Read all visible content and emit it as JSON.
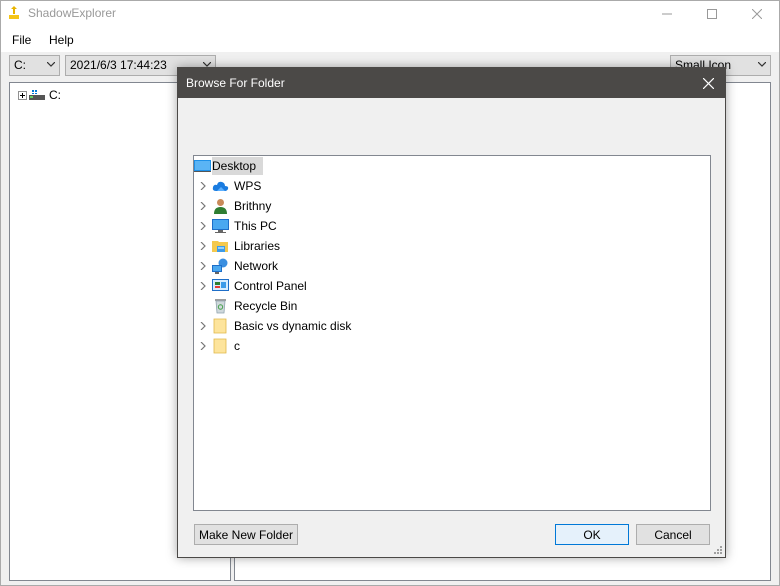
{
  "app": {
    "title": "ShadowExplorer",
    "menu": [
      "File",
      "Help"
    ],
    "toolbar": {
      "drive": "C:",
      "snapshot": "2021/6/3 17:44:23",
      "view_mode": "Small Icon"
    },
    "tree": {
      "root_label": "C:"
    }
  },
  "dialog": {
    "title": "Browse For Folder",
    "items": [
      {
        "label": "Desktop",
        "icon": "desktop-icon"
      },
      {
        "label": "WPS",
        "icon": "cloud-icon"
      },
      {
        "label": "Brithny",
        "icon": "user-icon"
      },
      {
        "label": "This PC",
        "icon": "computer-icon"
      },
      {
        "label": "Libraries",
        "icon": "libraries-icon"
      },
      {
        "label": "Network",
        "icon": "network-icon"
      },
      {
        "label": "Control Panel",
        "icon": "control-panel-icon"
      },
      {
        "label": "Recycle Bin",
        "icon": "recycle-bin-icon"
      },
      {
        "label": "Basic vs dynamic disk",
        "icon": "folder-icon"
      },
      {
        "label": "c",
        "icon": "folder-icon"
      }
    ],
    "buttons": {
      "make_new_folder": "Make New Folder",
      "ok": "OK",
      "cancel": "Cancel"
    }
  },
  "colors": {
    "dialog_title_bg": "#4b4947",
    "selection_bg": "#d9d9d9",
    "default_button_border": "#0078d7"
  }
}
